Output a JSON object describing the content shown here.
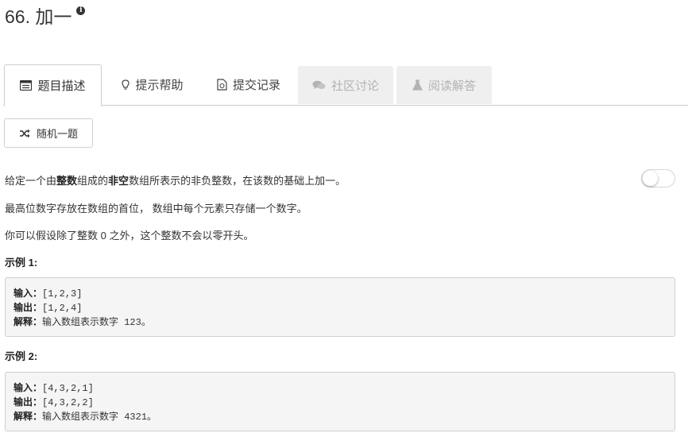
{
  "problem": {
    "title": "66. 加一"
  },
  "tabs": [
    {
      "label": "题目描述",
      "icon": "list-icon",
      "state": "active"
    },
    {
      "label": "提示帮助",
      "icon": "lightbulb-icon",
      "state": "normal"
    },
    {
      "label": "提交记录",
      "icon": "document-icon",
      "state": "normal"
    },
    {
      "label": "社区讨论",
      "icon": "comments-icon",
      "state": "disabled"
    },
    {
      "label": "阅读解答",
      "icon": "flask-icon",
      "state": "disabled"
    }
  ],
  "random_button": {
    "label": "随机一题",
    "icon": "shuffle-icon"
  },
  "description": {
    "p1": {
      "a": "给定一个由",
      "b": "整数",
      "c": "组成的",
      "d": "非空",
      "e": "数组所表示的非负整数，在该数的基础上加一。"
    },
    "p2": "最高位数字存放在数组的首位， 数组中每个元素只存储一个数字。",
    "p3": "你可以假设除了整数 0 之外，这个整数不会以零开头。"
  },
  "examples": [
    {
      "label": "示例 1:",
      "input_key": "输入：",
      "input": "[1,2,3]",
      "output_key": "输出：",
      "output": "[1,2,4]",
      "explain_key": "解释：",
      "explain": "输入数组表示数字 123。"
    },
    {
      "label": "示例 2:",
      "input_key": "输入：",
      "input": "[4,3,2,1]",
      "output_key": "输出：",
      "output": "[4,3,2,2]",
      "explain_key": "解释：",
      "explain": "输入数组表示数字 4321。"
    }
  ],
  "toggle": {
    "on": false
  }
}
